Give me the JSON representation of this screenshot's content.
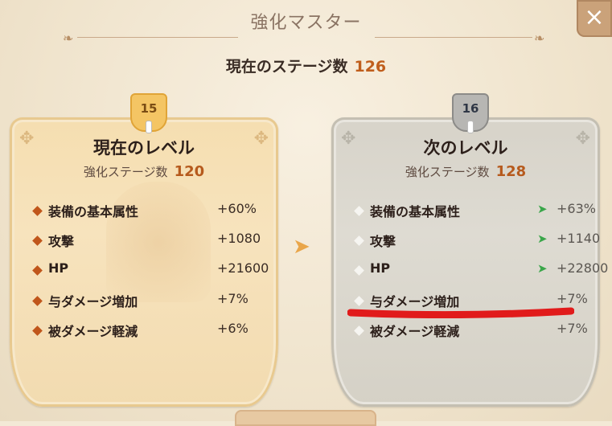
{
  "header": {
    "title": "強化マスター",
    "stage_label": "現在のステージ数",
    "stage_value": "126",
    "close_symbol": "×"
  },
  "current": {
    "badge": "15",
    "title": "現在のレベル",
    "sub_label": "強化ステージ数",
    "sub_value": "120",
    "stats": [
      {
        "name": "装備の基本属性",
        "value": "+60%"
      },
      {
        "name": "攻撃",
        "value": "+1080"
      },
      {
        "name": "HP",
        "value": "+21600"
      },
      {
        "name": "与ダメージ増加",
        "value": "+7%"
      },
      {
        "name": "被ダメージ軽減",
        "value": "+6%"
      }
    ]
  },
  "next": {
    "badge": "16",
    "title": "次のレベル",
    "sub_label": "強化ステージ数",
    "sub_value": "128",
    "stats": [
      {
        "name": "装備の基本属性",
        "value": "+63%",
        "arrow": true
      },
      {
        "name": "攻撃",
        "value": "+1140",
        "arrow": true
      },
      {
        "name": "HP",
        "value": "+22800",
        "arrow": true
      },
      {
        "name": "与ダメージ増加",
        "value": "+7%",
        "arrow": false
      },
      {
        "name": "被ダメージ軽減",
        "value": "+7%",
        "arrow": false
      }
    ]
  },
  "colors": {
    "accent_orange": "#c05e1c",
    "increase_arrow": "#3aa64a",
    "annotation_red": "#e11b1b"
  }
}
